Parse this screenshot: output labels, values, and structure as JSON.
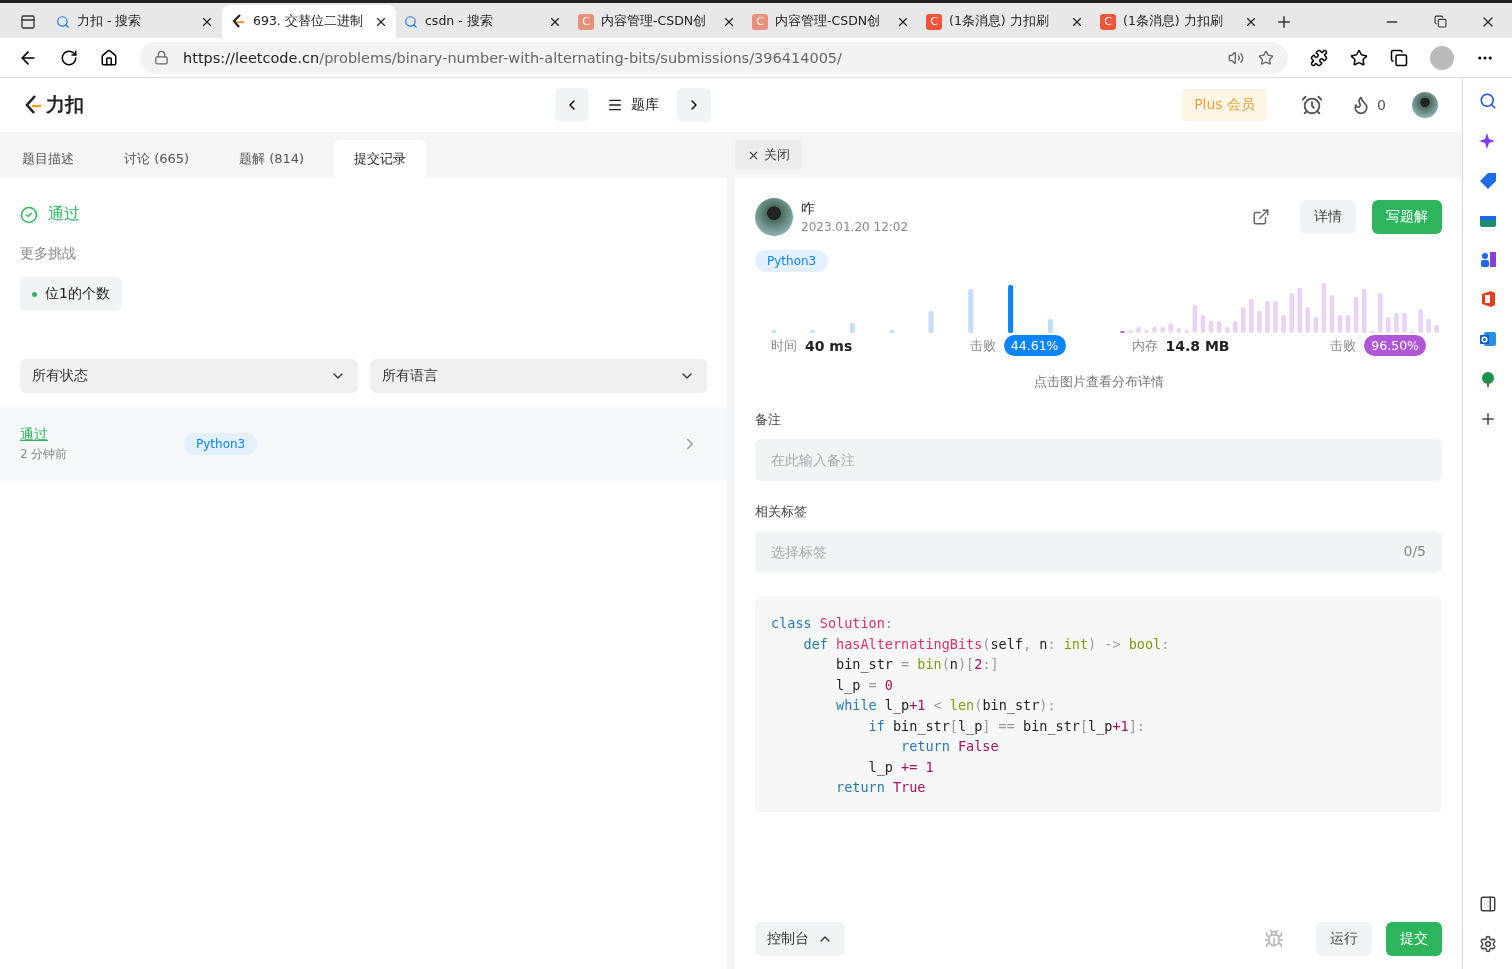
{
  "browser": {
    "tabs": [
      {
        "title": "力扣 - 搜索",
        "kind": "search",
        "selected": false
      },
      {
        "title": "693. 交替位二进制",
        "kind": "leetcode",
        "selected": true
      },
      {
        "title": "csdn - 搜索",
        "kind": "search",
        "selected": false
      },
      {
        "title": "内容管理-CSDN创",
        "kind": "csdn",
        "icon_text": "C",
        "selected": false
      },
      {
        "title": "内容管理-CSDN创",
        "kind": "csdn",
        "icon_text": "C",
        "selected": false
      },
      {
        "title": "(1条消息) 力扣刷",
        "kind": "csdn-red",
        "icon_text": "C",
        "selected": false
      },
      {
        "title": "(1条消息) 力扣刷",
        "kind": "csdn-red",
        "icon_text": "C",
        "selected": false
      }
    ],
    "url_host": "https://leetcode.cn",
    "url_path": "/problems/binary-number-with-alternating-bits/submissions/396414005/"
  },
  "header": {
    "logo": "力扣",
    "problem_bank": "题库",
    "plus": "Plus 会员",
    "streak": "0"
  },
  "left": {
    "tabs": [
      {
        "label": "题目描述",
        "selected": false
      },
      {
        "label": "讨论 (665)",
        "selected": false
      },
      {
        "label": "题解 (814)",
        "selected": false
      },
      {
        "label": "提交记录",
        "selected": true
      }
    ],
    "status": "通过",
    "more_title": "更多挑战",
    "challenge": "位1的个数",
    "filters": [
      {
        "label": "所有状态"
      },
      {
        "label": "所有语言"
      }
    ],
    "submissions": [
      {
        "status": "通过",
        "time": "2 分钟前",
        "language": "Python3"
      }
    ]
  },
  "right": {
    "close": "关闭",
    "user": "咋",
    "date": "2023.01.20 12:02",
    "details": "详情",
    "write": "写题解",
    "language": "Python3",
    "runtime": {
      "label": "时间",
      "value": "40 ms",
      "beat_label": "击败",
      "beat": "44.61%"
    },
    "memory": {
      "label": "内存",
      "value": "14.8 MB",
      "beat_label": "击败",
      "beat": "96.50%"
    },
    "hint": "点击图片查看分布详情",
    "note_label": "备注",
    "note_placeholder": "在此输入备注",
    "tags_label": "相关标签",
    "tags_placeholder": "选择标签",
    "tags_count": "0/5",
    "code": [
      [
        {
          "t": "class ",
          "kind": "kw"
        },
        {
          "t": "Solution",
          "kind": "name"
        },
        {
          "t": ":",
          "kind": "punct"
        }
      ],
      [
        {
          "t": "    def ",
          "kind": "kw"
        },
        {
          "t": "hasAlternatingBits",
          "kind": "name"
        },
        {
          "t": "(",
          "kind": "punct"
        },
        {
          "t": "self",
          "kind": "plain"
        },
        {
          "t": ", ",
          "kind": "punct"
        },
        {
          "t": "n",
          "kind": "plain"
        },
        {
          "t": ": ",
          "kind": "punct"
        },
        {
          "t": "int",
          "kind": "builtin"
        },
        {
          "t": ") -> ",
          "kind": "punct"
        },
        {
          "t": "bool",
          "kind": "builtin"
        },
        {
          "t": ":",
          "kind": "punct"
        }
      ],
      [
        {
          "t": "        bin_str ",
          "kind": "plain"
        },
        {
          "t": "= ",
          "kind": "punct"
        },
        {
          "t": "bin",
          "kind": "builtin"
        },
        {
          "t": "(",
          "kind": "punct"
        },
        {
          "t": "n",
          "kind": "plain"
        },
        {
          "t": ")[",
          "kind": "punct"
        },
        {
          "t": "2",
          "kind": "num"
        },
        {
          "t": ":]",
          "kind": "punct"
        }
      ],
      [
        {
          "t": "        l_p ",
          "kind": "plain"
        },
        {
          "t": "= ",
          "kind": "punct"
        },
        {
          "t": "0",
          "kind": "num"
        }
      ],
      [
        {
          "t": "        while ",
          "kind": "kw"
        },
        {
          "t": "l_p",
          "kind": "plain"
        },
        {
          "t": "+1",
          "kind": "num"
        },
        {
          "t": " < ",
          "kind": "punct"
        },
        {
          "t": "len",
          "kind": "builtin"
        },
        {
          "t": "(",
          "kind": "punct"
        },
        {
          "t": "bin_str",
          "kind": "plain"
        },
        {
          "t": "):",
          "kind": "punct"
        }
      ],
      [
        {
          "t": "            if ",
          "kind": "kw"
        },
        {
          "t": "bin_str",
          "kind": "plain"
        },
        {
          "t": "[",
          "kind": "punct"
        },
        {
          "t": "l_p",
          "kind": "plain"
        },
        {
          "t": "] == ",
          "kind": "punct"
        },
        {
          "t": "bin_str",
          "kind": "plain"
        },
        {
          "t": "[",
          "kind": "punct"
        },
        {
          "t": "l_p",
          "kind": "plain"
        },
        {
          "t": "+1",
          "kind": "num"
        },
        {
          "t": "]:",
          "kind": "punct"
        }
      ],
      [
        {
          "t": "                return ",
          "kind": "kw"
        },
        {
          "t": "False",
          "kind": "num"
        }
      ],
      [
        {
          "t": "            l_p ",
          "kind": "plain"
        },
        {
          "t": "+= ",
          "kind": "num"
        },
        {
          "t": "1",
          "kind": "num"
        }
      ],
      [
        {
          "t": "        return ",
          "kind": "kw"
        },
        {
          "t": "True",
          "kind": "num"
        }
      ]
    ]
  },
  "footer": {
    "console": "控制台",
    "run": "运行",
    "submit": "提交"
  }
}
